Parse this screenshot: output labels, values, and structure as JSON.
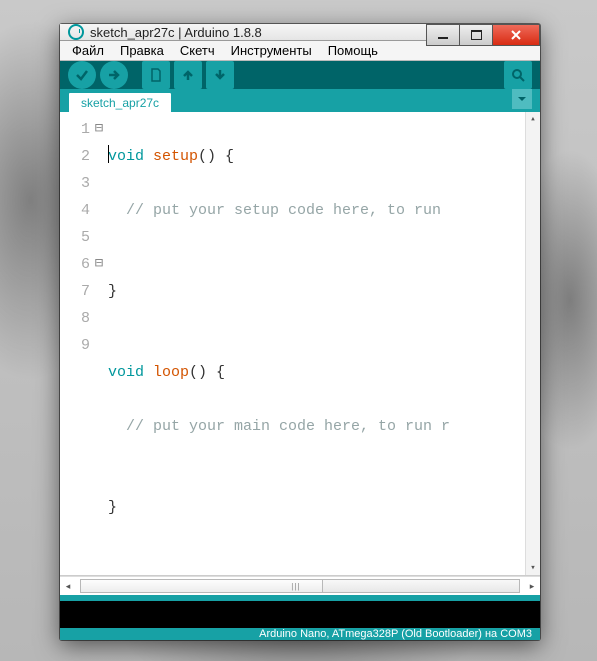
{
  "window": {
    "title": "sketch_apr27c | Arduino 1.8.8"
  },
  "menubar": {
    "file": "Файл",
    "edit": "Правка",
    "sketch": "Скетч",
    "tools": "Инструменты",
    "help": "Помощь"
  },
  "tabs": {
    "active": "sketch_apr27c"
  },
  "code": {
    "l1a": "void",
    "l1b": " ",
    "l1c": "setup",
    "l1d": "() {",
    "l2": "  // put your setup code here, to run ",
    "l3": "",
    "l4": "}",
    "l5": "",
    "l6a": "void",
    "l6b": " ",
    "l6c": "loop",
    "l6d": "() {",
    "l7": "  // put your main code here, to run r",
    "l8": "",
    "l9": "}"
  },
  "gutter": {
    "n1": "1",
    "n2": "2",
    "n3": "3",
    "n4": "4",
    "n5": "5",
    "n6": "6",
    "n7": "7",
    "n8": "8",
    "n9": "9"
  },
  "fold": {
    "f1": "⊟",
    "f6": "⊟"
  },
  "status": {
    "text": "Arduino Nano, ATmega328P (Old Bootloader) на COM3"
  },
  "hscroll": {
    "grip": "|||"
  }
}
